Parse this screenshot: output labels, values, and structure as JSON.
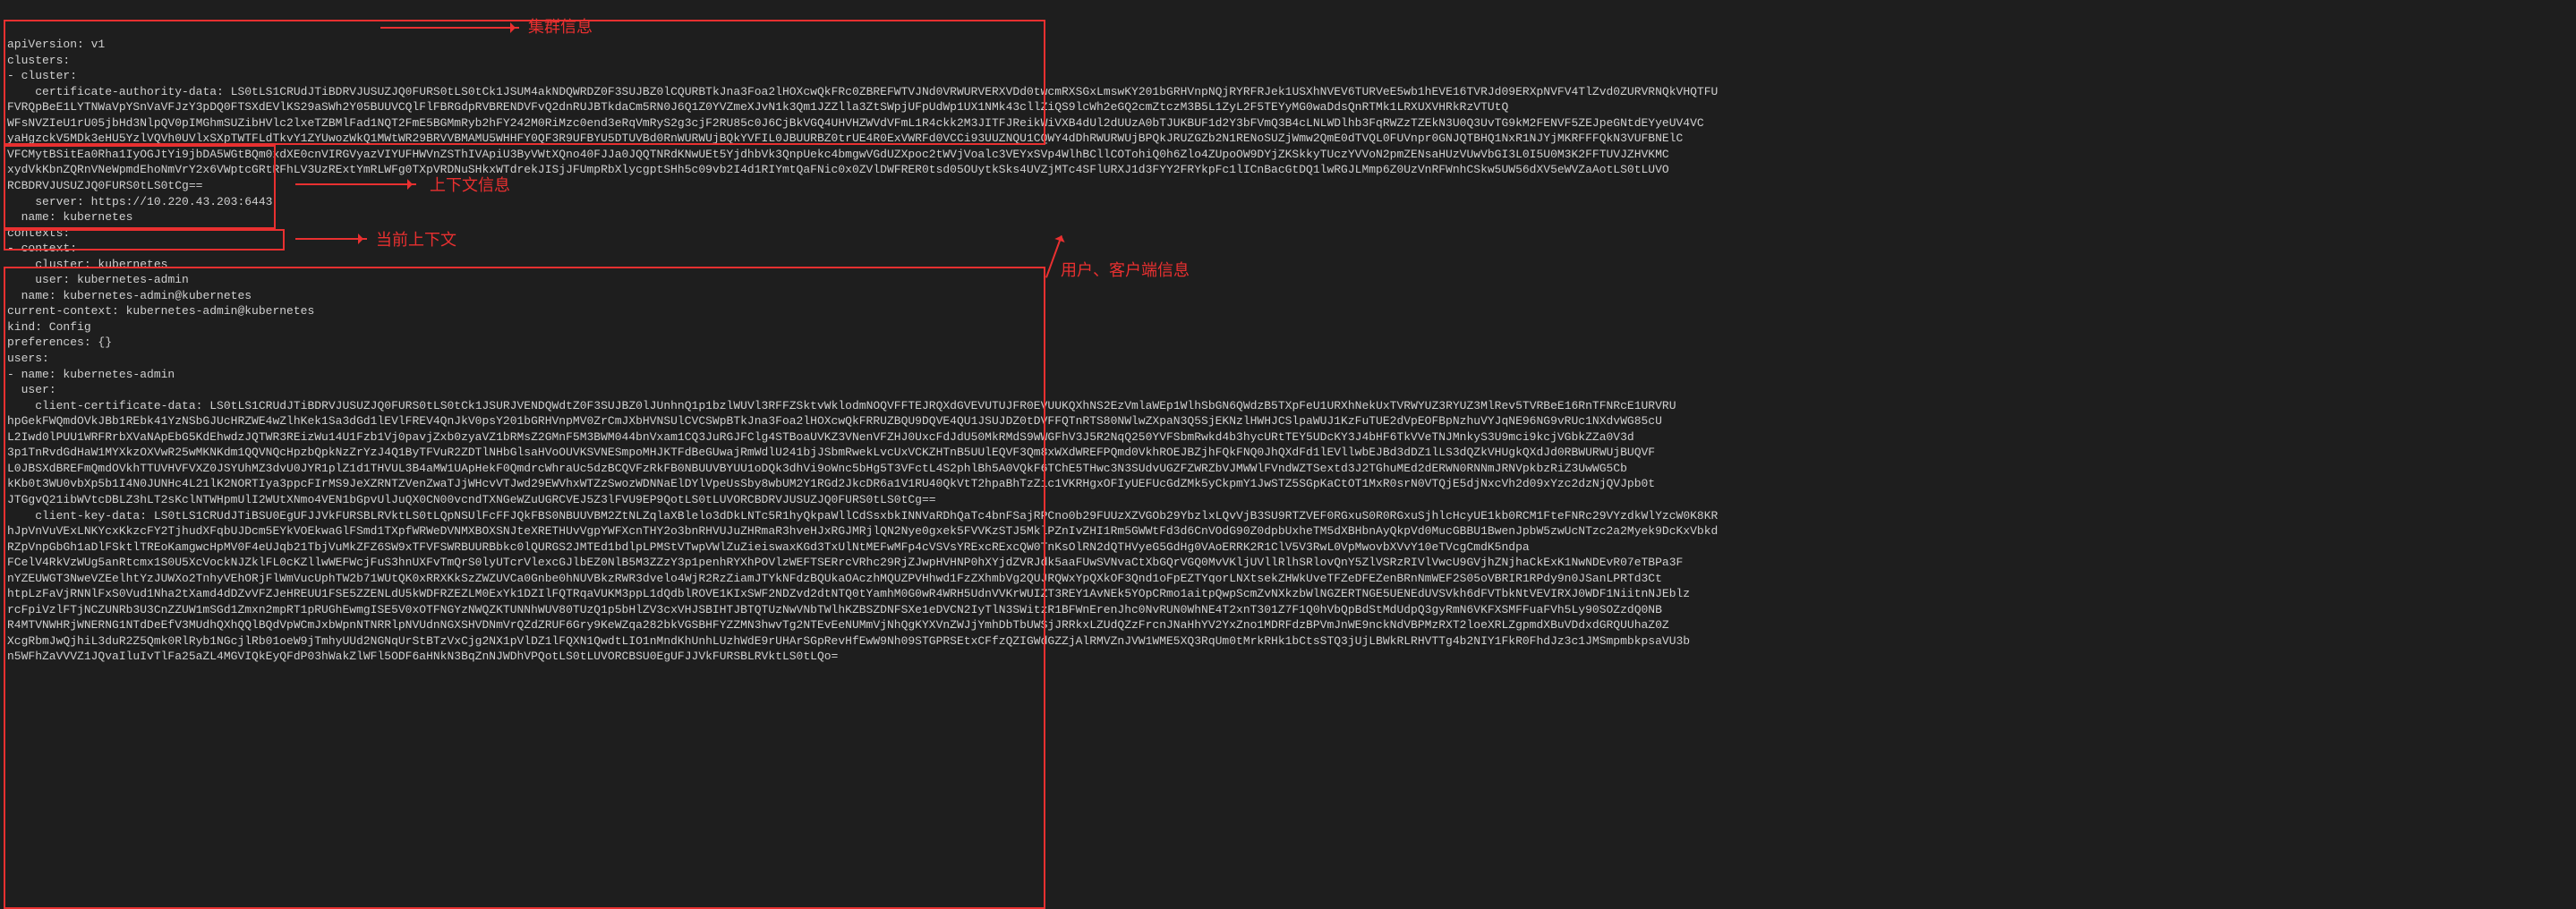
{
  "annotations": {
    "cluster_info": "集群信息",
    "context_info": "上下文信息",
    "current_context": "当前上下文",
    "user_info": "用户、客户端信息"
  },
  "colors": {
    "accent": "#e93030",
    "bg": "#1e1e1e",
    "fg": "#d0d0d0"
  },
  "config_lines": [
    "apiVersion: v1",
    "clusters:",
    "- cluster:",
    "    certificate-authority-data: LS0tLS1CRUdJTiBDRVJUSUZJQ0FURS0tLS0tCk1JSUM4akNDQWRDZ0F3SUJBZ0lCQURBTkJna3Foa2lHOXcwQkFRc0ZBREFWTVJNd0VRWURVERXVDd0twcmRXSGxLmswKY201bGRHVnpNQjRYRFRJek1USXhNVEV6TURVeE5wb1hEVE16TVRJd09ERXpNVFV4TlZvd0ZURVRNQkVHQTFU",
    "FVRQpBeE1LYTNWaVpYSnVaVFJzY3pDQ0FTSXdEVlKS29aSWh2Y05BUUVCQlFlFBRGdpRVBRENDVFvQ2dnRUJBTkdaCm5RN0J6Q1Z0YVZmeXJvN1k3Qm1JZZlla3ZtSWpjUFpUdWp1UX1NMk43cllZiQS9lcWh2eGQ2cmZtczM3B5L1ZyL2F5TEYyMG0waDdsQnRTMk1LRXUXVHRkRzVTUtQ",
    "WFsNVZIeU1rU05jbHd3NlpQV0pIMGhmSUZibHVlc2lxeTZBMlFad1NQT2FmE5BGMmRyb2hFY242M0RiMzc0end3eRqVmRyS2g3cjF2RU85c0J6CjBkVGQ4UHVHZWVdVFmL1R4ckk2M3JITFJReikWiVXB4dUl2dUUzA0bTJUKBUF1d2Y3bFVmQ3B4cLNLWDlhb3FqRWZzTZEkN3U0Q3UvTG9kM2FENVF5ZEJpeGNtdEYyeUV4VC",
    "yaHgzckV5MDk3eHU5YzlVQVh0UVlxSXpTWTFLdTkvY1ZYUwozWkQ1MWtWR29BRVVBMAMU5WHHFY0QF3R9UFBYU5DTUVBd0RnWURWUjBQkYVFIL0JBUURBZ0trUE4R0ExVWRFd0VCCi93UUZNQU1CQWY4dDhRWURWUjBPQkJRUZGZb2N1RENoSUZjWmw2QmE0dTVQL0FUVnpr0GNJQTBHQ1NxR1NJYjMKRFFFQkN3VUFBNElC",
    "VFCMytBSitEa0Rha1IyOGJtYi9jbDA5WGtBQm0xdXE0cnVIRGVyazVIYUFHWVnZSThIVApiU3ByVWtXQno40FJJa0JQQTNRdKNwUEt5YjdhbVk3QnpUekc4bmgwVGdUZXpoc2tWVjVoalc3VEYxSVp4WlhBCllCOTohiQ0h6Zlo4ZUpoOW9DYjZKSkkyTUczYVVoN2pmZENsaHUzVUwVbGI3L0I5U0M3K2FFTUVJZHVKMC",
    "xydVkKbnZQRnVNeWpmdEhoNmVrY2x6VWptcGRtRFhLV3UzRExtYmRLWFg0TXpVRDNuSHkxWTdrekJISjJFUmpRbXlycgptSHh5c09vb2I4d1RIYmtQaFNic0x0ZVlDWFRER0tsd05OUytkSks4UVZjMTc4SFlURXJ1d3FYY2FRYkpFc1lICnBacGtDQ1lwRGJLMmp6Z0UzVnRFWnhCSkw5UW56dXV5eWVZaAotLS0tLUVO",
    "RCBDRVJUSUZJQ0FURS0tLS0tCg==",
    "    server: https://10.220.43.203:6443",
    "  name: kubernetes",
    "contexts:",
    "- context:",
    "    cluster: kubernetes",
    "    user: kubernetes-admin",
    "  name: kubernetes-admin@kubernetes",
    "current-context: kubernetes-admin@kubernetes",
    "kind: Config",
    "preferences: {}",
    "users:",
    "- name: kubernetes-admin",
    "  user:",
    "    client-certificate-data: LS0tLS1CRUdJTiBDRVJUSUZJQ0FURS0tLS0tCk1JSURJVENDQWdtZ0F3SUJBZ0lJUnhnQ1p1bzlWUVl3RFFZSktvWklodmNOQVFFTEJRQXdGVEVUTUJFR0EVUUKQXhNS2EzVmlaWEp1WlhSbGN6QWdzB5TXpFeU1URXhNekUxTVRWYUZ3RYUZ3MlRev5TVRBeE16RnTFNRcE1URVRU",
    "hpGekFWQmdOVkJBb1REbk41YzNSbGJUcHRZWE4wZlhKek1Sa3dGd1lEVlFREV4QnJkV0psY201bGRHVnpMV0ZrCmJXbHVNSUlCVCSWpBTkJna3Foa2lHOXcwQkFRRUZBQU9DQVE4QU1JSUJDZ0tDVFFQTnRTS80NWlwZXpaN3Q5SjEKNzlHWHJCSlpaWUJ1KzFuTUE2dVpEOFBpNzhuVYJqNE96NG9vRUc1NXdvWG85cU",
    "L2Iwd0lPUU1WRFRrbXVaNApEbG5KdEhwdzJQTWR3REizWu14U1Fzb1Vj0pavjZxb0zyaVZ1bRMsZ2GMnF5M3BWM044bnVxam1CQ3JuRGJFClg4STBoaUVKZ3VNenVFZHJ0UxcFdJdU50MkRMdS9WWGFhV3J5R2NqQ250YVFSbmRwkd4b3hycURtTEY5UDcKY3J4bHF6TkVVeTNJMnkyS3U9mci9kcjVGbkZZa0V3d",
    "3p1TnRvdGdHaW1MYXkzOXVwR25wMKNKdm1QQVNQcHpzbQpkNzZrYzJ4Q1ByTFVuR2ZDTlNHbGlsaHVoOUVKSVNESmpoMHJKTFdBeGUwajRmWdlU241bjJSbmRwekLvcUxVCKZHTnB5UUlEQVF3Qm8xWXdWREFPQmd0VkhROEJBZjhFQkFNQ0JhQXdFd1lEVllwbEJBd3dDZ1lLS3dQZkVHUgkQXdJd0RBWURWUjBUQVF",
    "L0JBSXdBREFmQmdOVkhTTUVHVFVXZ0JSYUhMZ3dvU0JYR1plZ1d1THVUL3B4aMW1UApHekF0QmdrcWhraUc5dzBCQVFzRkFB0NBUUVBYUU1oDQk3dhVi9oWnc5bHg5T3VFctL4S2phlBh5A0VQkF6TChE5THwc3N3SUdvUGZFZWRZbVJMWWlFVndWZTSextd3J2TGhuMEd2dERWN0RNNmJRNVpkbzRiZ3UwWG5Cb",
    "kKb0t3WU0vbXp5b1I4N0JUNHc4L21lK2NORTIya3ppcFIrMS9JeXZRNTZVenZwaTJjWHcvVTJwd29EWVhxWTZzSwozWDNNaElDYlVpeUsSby8wbUM2Y1RGd2JkcDR6a1V1RU40QkVtT2hpaBhTzZic1VKRHgxOFIyUEFUcGdZMk5yCkpmY1JwSTZ5SGpKaCtOT1MxR0srN0VTQjE5djNxcVh2d09xYzc2dzNjQVJpb0t",
    "JTGgvQ21ibWVtcDBLZ3hLT2sKclNTWHpmUlI2WUtXNmo4VEN1bGpvUlJuQX0CN00vcndTXNGeWZuUGRCVEJ5Z3lFVU9EP9QotLS0tLUVORCBDRVJUSUZJQ0FURS0tLS0tCg==",
    "    client-key-data: LS0tLS1CRUdJTiBSU0EgUFJJVkFURSBLRVktLS0tLQpNSUlFcFFJQkFBS0NBUUVBM2ZtNLZqlaXBlelo3dDkLNTc5R1hyQkpaWllCdSsxbkINNVaRDhQaTc4bnFSajRPCno0b29FUUzXZVGOb29YbzlxLQvVjB3SU9RTZVEF0RGxuS0R0RGxuSjhlcHcyUE1kb0RCM1FteFNRc29VYzdkWlYzcW0K8KR",
    "hJpVnVuVExLNKYcxKkzcFY2TjhudXFqbUJDcm5EYkVOEkwaGlFSmd1TXpfWRWeDVNMXBOXSNJteXRETHUvVgpYWFXcnTHY2o3bnRHVUJuZHRmaR3hveHJxRGJMRjlQN2Nye0gxek5FVVKzSTJ5MklPZnIvZHI1Rm5GWWtFd3d6CnVOdG90Z0dpbUxheTM5dXBHbnAyQkpVd0MucGBBU1BwenJpbW5zwUcNTzc2a2Myek9DcKxVbkd",
    "RZpVnpGbGh1aDlFSktlTREoKamgwcHpMV0F4eUJqb21TbjVuMkZFZ6SW9xTFVFSWRBUURBbkc0lQURGS2JMTEd1bdlpLPMStVTwpVWlZuZieiswaxKGd3TxUlNtMEFwMFp4cVSVsYRExcRExcQW0TnKsOlRN2dQTHVyeG5GdHg0VAoERRK2R1ClV5V3RwL0VpMwovbXVvY10eTVcgCmdK5ndpa",
    "FCelV4RkVzWUg5anRtcmx1S0U5XcVockNJZklFL0cKZllwWEFWcjFuS3hnUXFvTmQrS0lyUTcrVlexcGJlbEZ0NlB5M3ZZzY3p1penhRYXhPOVlzWEFTSERrcVRhc29RjZJwpHVHNP0hXYjdZVRJdk5aaFUwSVNvaCtXbGQrVGQ0MvVKljUVllRlhSRlovQnY5ZlVSRzRIVlVwcU9GVjhZNjhaCkExK1NwNDEvR07eTBPa3F",
    "nYZEUWGT3NweVZEelhtYzJUWXo2TnhyVEhORjFlWmVucUphTW2b71WUtQK0xRRXKkSzZWZUVCa0Gnbe0hNUVBkzRWR3dvelo4WjR2RzZiamJTYkNFdzBQUkaOAczhMQUZPVHhwd1FzZXhmbVg2QUJRQWxYpQXkOF3Qnd1oFpEZTYqorLNXtsekZHWkUveTFZeDFEZenBRnNmWEF2S05oVBRIR1RPdy9n0JSanLPRTd3Ct",
    "htpLzFaVjRNNlFxS0Vud1Nha2tXamd4dDZvVFZJeHREUU1FSE5ZZENLdU5kWDFRZEZLM0ExYk1DZIlFQTRqaVUKM3ppL1dQdblROVE1KIxSWF2NDZvd2dtNTQ0tYamhM0G0wR4WRH5UdnVVKrWUIZT3REY1AvNEk5YOpCRmo1aitpQwpScmZvNXkzbWlNGZERTNGE5UENEdUVSVkh6dFVTbkNtVEVIRXJ0WDF1NiitnNJEblz",
    "rcFpiVzlFTjNCZUNRb3U3CnZZUW1mSGd1Zmxn2mpRT1pRUGhEwmgISE5V0xOTFNGYzNWQZKTUNNhWUV80TUzQ1p5bHlZV3cxVHJSBIHTJBTQTUzNwVNbTWlhKZBSZDNFSXe1eDVCN2IyTlN3SWitzR1BFWnErenJhc0NvRUN0WhNE4T2xnT301Z7F1Q0hVbQpBdStMdUdpQ3gyRmN6VKFXSMFFuaFVh5Ly90SOZzdQ0NB",
    "R4MTVNWHRjWNERNG1NTdDeEfV3MUdhQXhQQlBQdVpWCmJxbWpnNTNRRlpNVUdnNGXSHVDNmVrQZdZRUF6Gry9KeWZqa282bkVGSBHFYZZMN3hwvTg2NTEvEeNUMmVjNhQgKYXVnZWJjYmhDbTbUWSjJRRkxLZUdQZzFrcnJNaHhYV2YxZno1MDRFdzBPVmJnWE9nckNdVBPMzRXT2loeXRLZgpmdXBuVDdxdGRQUUhaZ0Z",
    "XcgRbmJwQjhiL3duR2Z5Qmk0RlRyb1NGcjlRb01oeW9jTmhyUUd2NGNqUrStBTzVxCjg2NX1pVlDZ1lFQXN1QwdtLIO1nMndKhUnhLUzhWdE9rUHArSGpRevHfEwW9Nh09STGPRSEtxCFfzQZIGWdGZZjAlRMVZnJVW1WME5XQ3RqUm0tMrkRHk1bCtsSTQ3jUjLBWkRLRHVTTg4b2NIY1FkR0FhdJz3c1JMSmpmbkpsaVU3b",
    "n5WFhZaVVVZ1JQvaIluIvTlFa25aZL4MGVIQkEyQFdP03hWakZlWFl5ODF6aHNkN3BqZnNJWDhVPQotLS0tLUVORCBSU0EgUFJJVkFURSBLRVktLS0tLQo="
  ]
}
